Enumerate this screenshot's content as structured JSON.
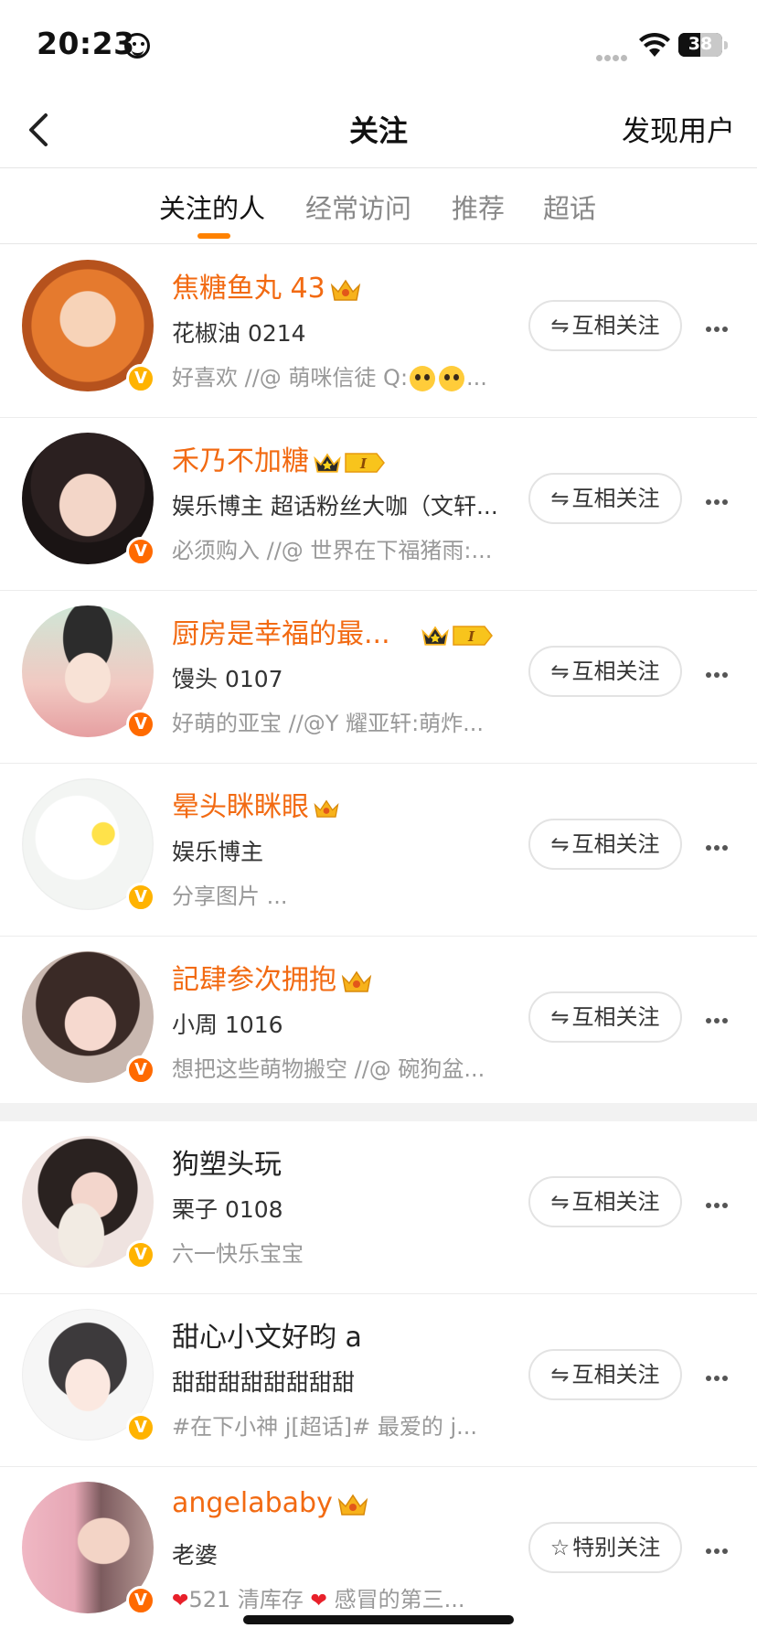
{
  "status_bar": {
    "time": "20:23",
    "battery": "38"
  },
  "nav": {
    "title": "关注",
    "right_action": "发现用户"
  },
  "tabs": [
    {
      "label": "关注的人",
      "active": true
    },
    {
      "label": "经常访问",
      "active": false
    },
    {
      "label": "推荐",
      "active": false
    },
    {
      "label": "超话",
      "active": false
    }
  ],
  "users": [
    {
      "name": "焦糖鱼丸 43",
      "name_color": "orange",
      "crown": true,
      "level": "",
      "desc": "花椒油 0214",
      "sub": "好喜欢 //@ 萌咪信徒 Q:",
      "sub_suffix": "...",
      "verify": "yellow",
      "button": "互相关注",
      "button_icon": "⇋"
    },
    {
      "name": "禾乃不加糖",
      "name_color": "orange",
      "crown": true,
      "level": "I",
      "desc": "娱乐博主 超话粉丝大咖（文轩...",
      "sub": "必须购入 //@ 世界在下福猪雨:...",
      "verify": "orange",
      "button": "互相关注",
      "button_icon": "⇋"
    },
    {
      "name": "厨房是幸福的最...",
      "name_color": "orange",
      "crown": true,
      "level": "I",
      "desc": "馒头 0107",
      "sub": "好萌的亚宝 //@Y 耀亚轩:萌炸...",
      "verify": "orange",
      "button": "互相关注",
      "button_icon": "⇋"
    },
    {
      "name": "晕头眯眯眼",
      "name_color": "orange",
      "crown": true,
      "level": "",
      "desc": "娱乐博主",
      "sub": "分享图片 ...",
      "verify": "yellow",
      "button": "互相关注",
      "button_icon": "⇋"
    },
    {
      "name": "記肆参次拥抱",
      "name_color": "orange",
      "crown": true,
      "level": "",
      "desc": "小周 1016",
      "sub": "想把这些萌物搬空 //@ 碗狗盆...",
      "verify": "orange",
      "button": "互相关注",
      "button_icon": "⇋"
    },
    {
      "name": "狗塑头玩",
      "name_color": "black",
      "crown": false,
      "level": "",
      "desc": "栗子 0108",
      "sub": "六一快乐宝宝",
      "verify": "yellow",
      "button": "互相关注",
      "button_icon": "⇋"
    },
    {
      "name": "甜心小文好昀 a",
      "name_color": "black",
      "crown": false,
      "level": "",
      "desc": "甜甜甜甜甜甜甜甜",
      "sub": "#在下小神 j[超话]#  最爱的 j...",
      "verify": "yellow",
      "button": "互相关注",
      "button_icon": "⇋"
    },
    {
      "name": "angelababy",
      "name_color": "orange",
      "crown": true,
      "level": "",
      "desc": "老婆",
      "sub": "521 清库存",
      "sub_mid": "感冒的第三...",
      "verify": "orange",
      "button": "特别关注",
      "button_icon": "☆"
    }
  ],
  "colors": {
    "accent": "#ff8200",
    "name_orange": "#f26a12",
    "verify_yellow": "#ffb300",
    "verify_orange": "#ff6a00"
  }
}
